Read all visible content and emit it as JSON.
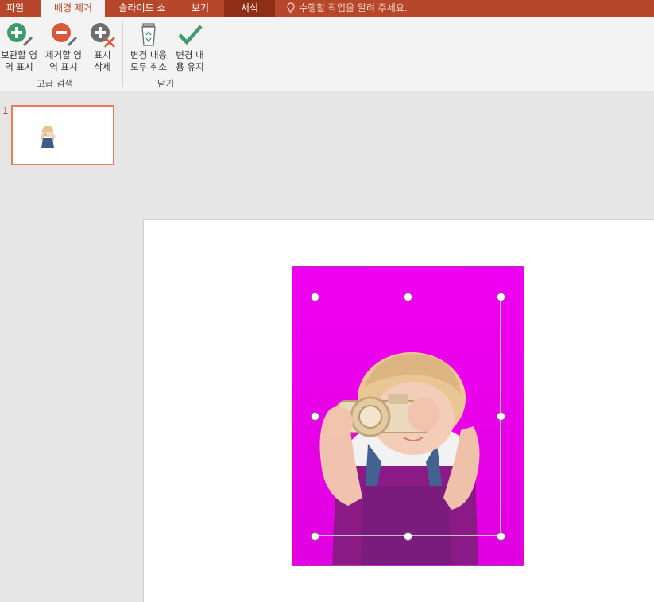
{
  "tabs": [
    {
      "label": "파일"
    },
    {
      "label": "배경 제거"
    },
    {
      "label": "슬라이드 쇼"
    },
    {
      "label": "보기"
    },
    {
      "label": "서식"
    }
  ],
  "tell_me": "수행할 작업을 알려 주세요.",
  "ribbon": {
    "mark_keep": {
      "line1": "보관할 영",
      "line2": "역 표시"
    },
    "mark_remove": {
      "line1": "제거할 영",
      "line2": "역 표시"
    },
    "delete_mark": {
      "line1": "표시",
      "line2": "삭제"
    },
    "discard": {
      "line1": "변경 내용",
      "line2": "모두 취소"
    },
    "keep": {
      "line1": "변경 내",
      "line2": "용 유지"
    },
    "group_refine": "고급 검색",
    "group_close": "닫기"
  },
  "thumbnail": {
    "number": "1"
  },
  "colors": {
    "accent": "#b7472a",
    "removal_overlay": "#f000f0",
    "thumb_border": "#e1805f"
  }
}
